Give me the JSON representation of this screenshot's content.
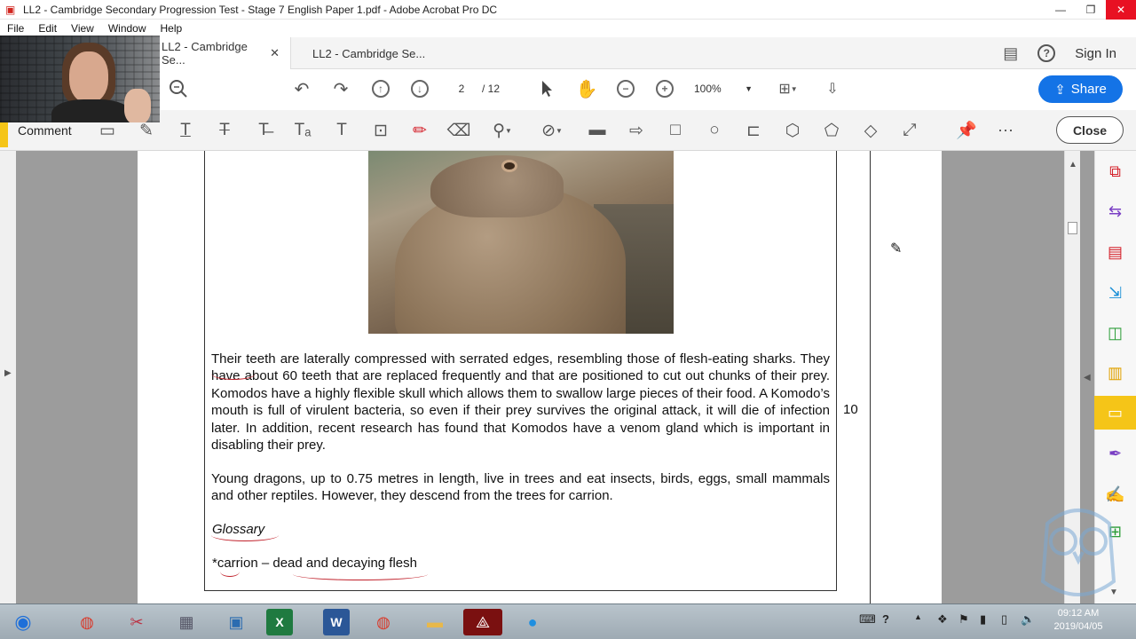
{
  "window": {
    "title": "LL2 - Cambridge Secondary Progression Test - Stage 7 English Paper 1.pdf - Adobe Acrobat Pro DC",
    "controls": {
      "minimize": "—",
      "restore": "❐",
      "close": "✕"
    }
  },
  "menu": [
    "File",
    "Edit",
    "View",
    "Window",
    "Help"
  ],
  "tabs": [
    {
      "label": "LL2 - Cambridge Se...",
      "close": "✕"
    },
    {
      "label": "LL2 - Cambridge Se..."
    }
  ],
  "header_right": {
    "help": "?",
    "sign_in": "Sign In"
  },
  "toolbar": {
    "page_current": "2",
    "page_total": "/ 12",
    "zoom": "100%",
    "share": "Share"
  },
  "comment_toolbar": {
    "label": "Comment",
    "close": "Close"
  },
  "document": {
    "paragraph1": "Their teeth are laterally compressed with serrated edges, resembling those of flesh-eating sharks. They have about 60 teeth that are replaced frequently and that are positioned to cut out chunks of their prey. Komodos have a highly flexible skull which allows them to swallow large pieces of their food. A Komodo’s mouth is full of virulent bacteria, so even if their prey survives the original attack, it will die of infection later. In addition, recent research has found that Komodos have a venom gland which is important in disabling their prey.",
    "paragraph2": "Young dragons, up to 0.75 metres in length, live in trees and eat insects, birds, eggs, small mammals and other reptiles.  However, they descend from the trees for carrion.",
    "glossary_heading": "Glossary",
    "glossary_entry": "*carrion – dead and decaying flesh",
    "page_marker": "10"
  },
  "taskbar": {
    "time": "09:12 AM",
    "date": "2019/04/05"
  },
  "colors": {
    "accent": "#1473e6",
    "highlight": "#f5c518",
    "annotation_red": "#c0202a"
  }
}
